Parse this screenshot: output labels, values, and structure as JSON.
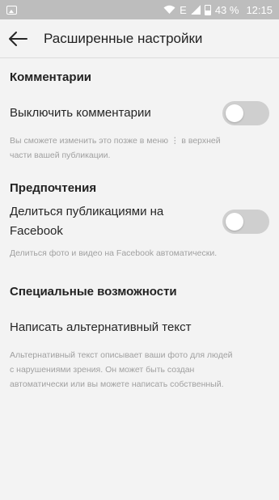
{
  "status_bar": {
    "battery": "43 %",
    "time": "12:15",
    "network": "E"
  },
  "header": {
    "title": "Расширенные настройки",
    "back_icon": "arrow-left-icon"
  },
  "sections": {
    "comments": {
      "heading": "Комментарии",
      "toggle_label": "Выключить комментарии",
      "toggle_on": false,
      "note_line1": "Вы сможете изменить это позже в меню ⋮ в верхней",
      "note_line2": "части вашей публикации."
    },
    "preferences": {
      "heading": "Предпочтения",
      "toggle_label_line1": "Делиться публикациями на",
      "toggle_label_line2": "Facebook",
      "toggle_on": false,
      "note": "Делиться фото и видео на Facebook автоматически."
    },
    "accessibility": {
      "heading": "Специальные возможности",
      "item_label": "Написать альтернативный текст",
      "note_line1": "Альтернативный текст описывает ваши фото для людей",
      "note_line2": "с нарушениями зрения. Он может быть создан",
      "note_line3": "автоматически или вы можете написать собственный."
    }
  }
}
